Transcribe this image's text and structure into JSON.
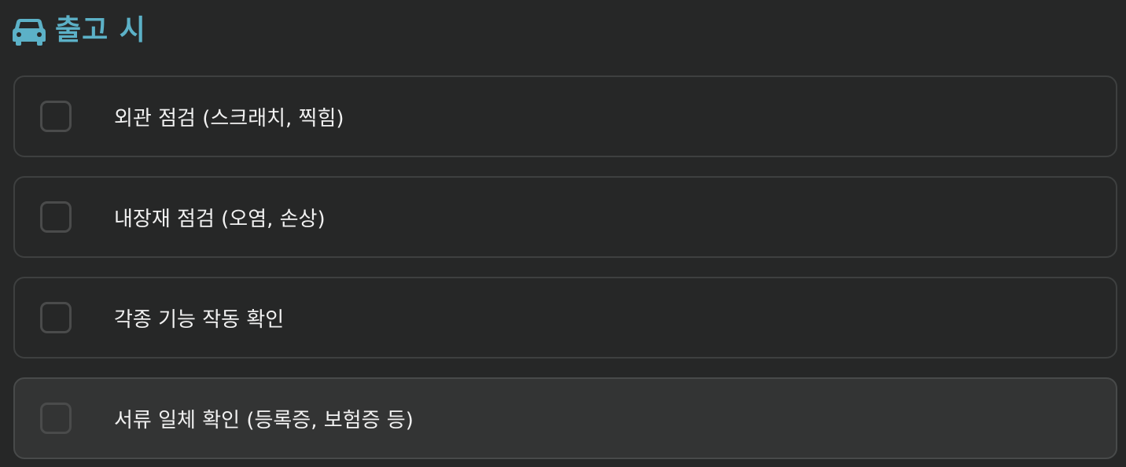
{
  "header": {
    "icon": "car-icon",
    "title": "출고 시",
    "accent_color": "#5cb1c7"
  },
  "checklist": {
    "items": [
      {
        "label": "외관 점검 (스크래치, 찍힘)",
        "checked": false
      },
      {
        "label": "내장재 점검 (오염, 손상)",
        "checked": false
      },
      {
        "label": "각종 기능 작동 확인",
        "checked": false
      },
      {
        "label": "서류 일체 확인 (등록증, 보험증 등)",
        "checked": false
      }
    ]
  }
}
